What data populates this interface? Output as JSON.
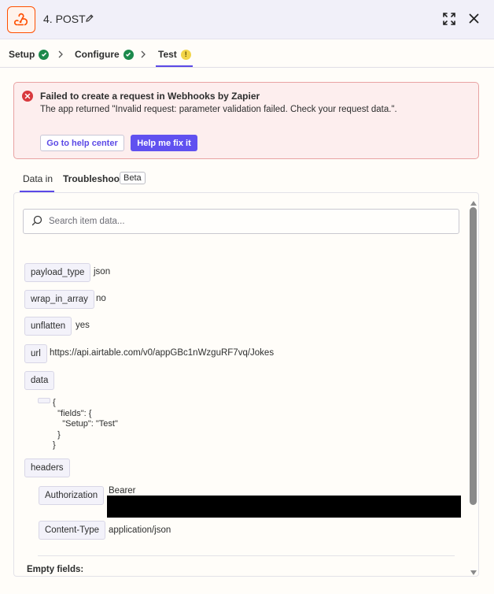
{
  "header": {
    "step_title": "4. POST",
    "app_icon": "webhook-icon",
    "brand_color": "#ff4f00"
  },
  "tabs": [
    {
      "label": "Setup",
      "status": "complete"
    },
    {
      "label": "Configure",
      "status": "complete"
    },
    {
      "label": "Test",
      "status": "warning",
      "active": true
    }
  ],
  "error": {
    "title": "Failed to create a request in Webhooks by Zapier",
    "message": "The app returned \"Invalid request: parameter validation failed. Check your request data.\".",
    "help_button": "Go to help center",
    "fix_button": "Help me fix it"
  },
  "subtabs": {
    "data_in": "Data in",
    "troubleshoot": "Troubleshoot",
    "beta": "Beta"
  },
  "search": {
    "placeholder": "Search item data..."
  },
  "fields": {
    "payload_type": {
      "key": "payload_type",
      "value": "json"
    },
    "wrap_in_array": {
      "key": "wrap_in_array",
      "value": "no"
    },
    "unflatten": {
      "key": "unflatten",
      "value": "yes"
    },
    "url": {
      "key": "url",
      "value": "https://api.airtable.com/v0/appGBc1nWzguRF7vq/Jokes"
    },
    "data": {
      "key": "data",
      "value": "{\n  \"fields\": {\n    \"Setup\": \"Test\"\n  }\n}"
    },
    "headers": {
      "key": "headers"
    },
    "authorization": {
      "key": "Authorization",
      "value": "Bearer"
    },
    "content_type": {
      "key": "Content-Type",
      "value": "application/json"
    }
  },
  "empty_fields_label": "Empty fields:"
}
